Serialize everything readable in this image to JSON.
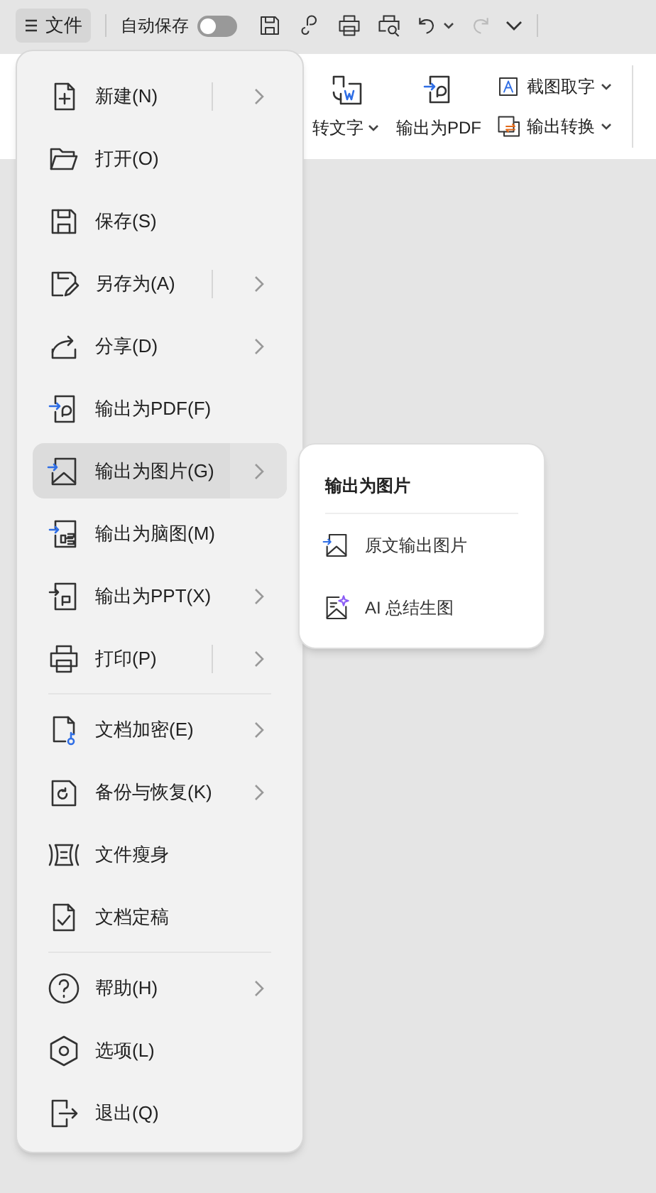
{
  "toolbar": {
    "file_menu_label": "文件",
    "autosave_label": "自动保存",
    "autosave_on": false,
    "redo_disabled": true
  },
  "ribbon": {
    "items": [
      {
        "label": "转文字",
        "kind": "pic2text",
        "caret": true
      },
      {
        "label": "输出为PDF",
        "kind": "pdf",
        "caret": false
      }
    ],
    "small_items": [
      {
        "label": "截图取字",
        "kind": "ocr",
        "caret": true
      },
      {
        "label": "输出转换",
        "kind": "convert",
        "caret": true
      }
    ]
  },
  "menu": {
    "groups": [
      [
        {
          "label": "新建(N)",
          "kind": "new",
          "submenu": true,
          "split": true,
          "selected": false
        },
        {
          "label": "打开(O)",
          "kind": "open",
          "submenu": false,
          "split": false,
          "selected": false
        },
        {
          "label": "保存(S)",
          "kind": "save",
          "submenu": false,
          "split": false,
          "selected": false
        },
        {
          "label": "另存为(A)",
          "kind": "saveas",
          "submenu": true,
          "split": true,
          "selected": false
        },
        {
          "label": "分享(D)",
          "kind": "share",
          "submenu": true,
          "split": false,
          "selected": false
        },
        {
          "label": "输出为PDF(F)",
          "kind": "pdf",
          "submenu": false,
          "split": false,
          "selected": false
        },
        {
          "label": "输出为图片(G)",
          "kind": "image",
          "submenu": true,
          "split": false,
          "selected": true
        },
        {
          "label": "输出为脑图(M)",
          "kind": "mindmap",
          "submenu": false,
          "split": false,
          "selected": false
        },
        {
          "label": "输出为PPT(X)",
          "kind": "ppt",
          "submenu": true,
          "split": false,
          "selected": false
        },
        {
          "label": "打印(P)",
          "kind": "print",
          "submenu": true,
          "split": true,
          "selected": false
        }
      ],
      [
        {
          "label": "文档加密(E)",
          "kind": "encrypt",
          "submenu": true,
          "split": false,
          "selected": false
        },
        {
          "label": "备份与恢复(K)",
          "kind": "backup",
          "submenu": true,
          "split": false,
          "selected": false
        },
        {
          "label": "文件瘦身",
          "kind": "slim",
          "submenu": false,
          "split": false,
          "selected": false
        },
        {
          "label": "文档定稿",
          "kind": "final",
          "submenu": false,
          "split": false,
          "selected": false
        }
      ],
      [
        {
          "label": "帮助(H)",
          "kind": "help",
          "submenu": true,
          "split": false,
          "selected": false
        },
        {
          "label": "选项(L)",
          "kind": "options",
          "submenu": false,
          "split": false,
          "selected": false
        },
        {
          "label": "退出(Q)",
          "kind": "exit",
          "submenu": false,
          "split": false,
          "selected": false
        }
      ]
    ]
  },
  "submenu": {
    "title": "输出为图片",
    "items": [
      {
        "label": "原文输出图片",
        "kind": "image"
      },
      {
        "label": "AI 总结生图",
        "kind": "ai-image"
      }
    ]
  }
}
